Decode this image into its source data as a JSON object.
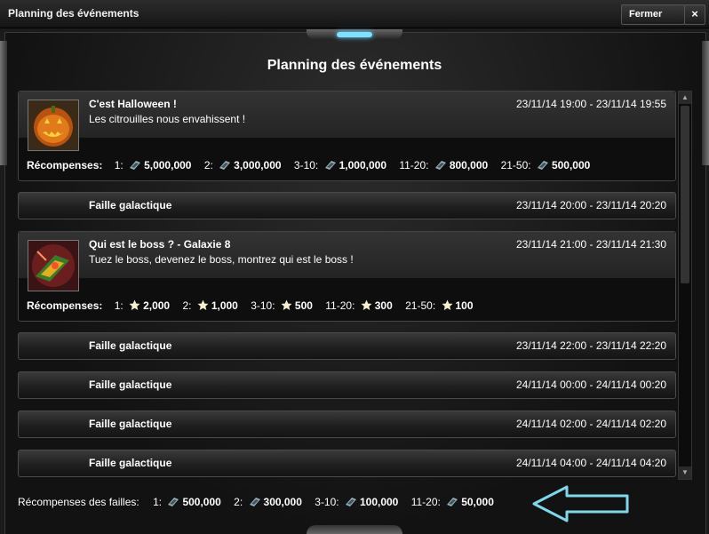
{
  "window": {
    "title": "Planning des événements",
    "close_label": "Fermer",
    "x_label": "×"
  },
  "heading": "Planning des événements",
  "rewards_label": "Récompenses:",
  "events": [
    {
      "title": "C'est Halloween !",
      "date": "23/11/14 19:00 - 23/11/14 19:55",
      "desc": "Les citrouilles nous envahissent !",
      "icon": "pumpkin-icon",
      "rewards": [
        {
          "rank": "1:",
          "value": "5,000,000"
        },
        {
          "rank": "2:",
          "value": "3,000,000"
        },
        {
          "rank": "3-10:",
          "value": "1,000,000"
        },
        {
          "rank": "11-20:",
          "value": "800,000"
        },
        {
          "rank": "21-50:",
          "value": "500,000"
        }
      ]
    },
    {
      "title": "Faille galactique",
      "date": "23/11/14 20:00 - 23/11/14 20:20"
    },
    {
      "title": "Qui est le boss ?  -  Galaxie 8",
      "date": "23/11/14 21:00 - 23/11/14 21:30",
      "desc": "Tuez le boss, devenez le boss, montrez qui est le boss !",
      "icon": "boss-ship-icon",
      "rewards": [
        {
          "rank": "1:",
          "value": "2,000"
        },
        {
          "rank": "2:",
          "value": "1,000"
        },
        {
          "rank": "3-10:",
          "value": "500"
        },
        {
          "rank": "11-20:",
          "value": "300"
        },
        {
          "rank": "21-50:",
          "value": "100"
        }
      ]
    },
    {
      "title": "Faille galactique",
      "date": "23/11/14 22:00 - 23/11/14 22:20"
    },
    {
      "title": "Faille galactique",
      "date": "24/11/14 00:00 - 24/11/14 00:20"
    },
    {
      "title": "Faille galactique",
      "date": "24/11/14 02:00 - 24/11/14 02:20"
    },
    {
      "title": "Faille galactique",
      "date": "24/11/14 04:00 - 24/11/14 04:20"
    }
  ],
  "footer": {
    "label": "Récompenses des failles:",
    "rewards": [
      {
        "rank": "1:",
        "value": "500,000"
      },
      {
        "rank": "2:",
        "value": "300,000"
      },
      {
        "rank": "3-10:",
        "value": "100,000"
      },
      {
        "rank": "11-20:",
        "value": "50,000"
      }
    ]
  },
  "icons": {
    "credit": "credit-chip-icon",
    "star": "star-icon",
    "arrow": "left-arrow-icon"
  },
  "colors": {
    "arrow": "#7fd8ea",
    "background": "#1b1b1b",
    "text": "#ffffff"
  }
}
